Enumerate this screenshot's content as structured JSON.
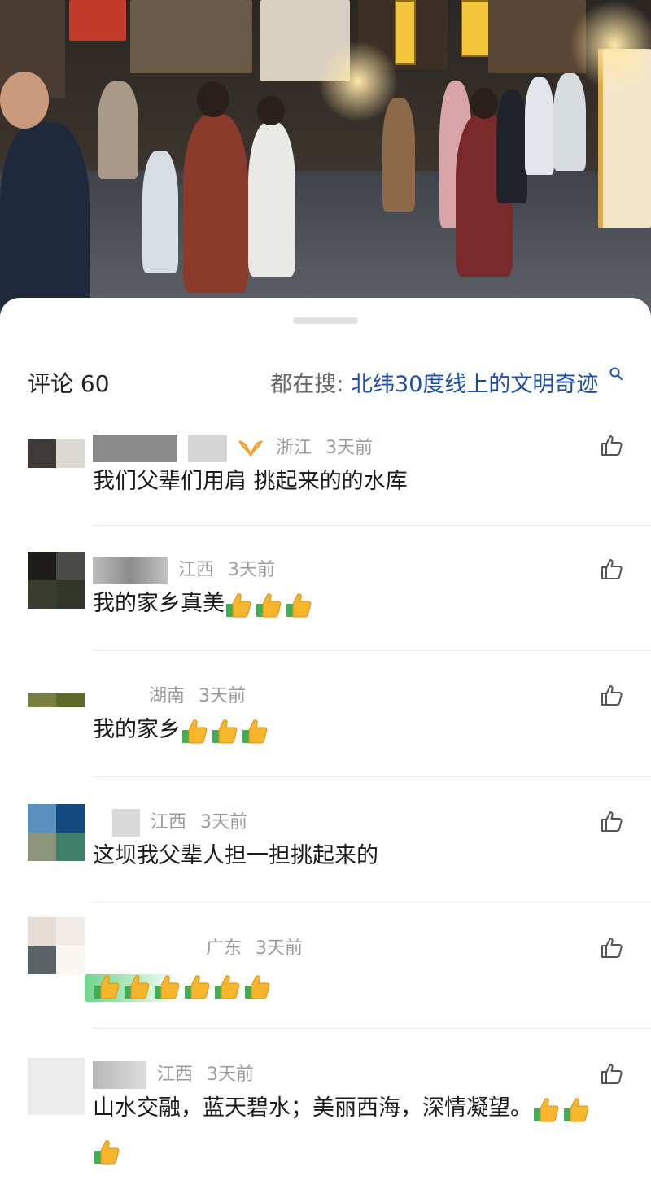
{
  "video": {
    "description_icon": "video-frame"
  },
  "header": {
    "comment_count_label": "评论 60",
    "trending_label": "都在搜:",
    "trending_term": "北纬30度线上的文明奇迹",
    "trending_icon": "search-icon"
  },
  "comments": [
    {
      "region": "浙江",
      "time": "3天前",
      "text": "我们父辈们用肩 挑起来的的水库",
      "thumbs": 0,
      "like_icon": "thumbs-up-outline-icon"
    },
    {
      "region": "江西",
      "time": "3天前",
      "text": "我的家乡真美",
      "thumbs": 3,
      "like_icon": "thumbs-up-outline-icon"
    },
    {
      "region": "湖南",
      "time": "3天前",
      "text": "我的家乡",
      "thumbs": 3,
      "like_icon": "thumbs-up-outline-icon"
    },
    {
      "region": "江西",
      "time": "3天前",
      "text": "这坝我父辈人担一担挑起来的",
      "thumbs": 0,
      "like_icon": "thumbs-up-outline-icon"
    },
    {
      "region": "广东",
      "time": "3天前",
      "text": "",
      "thumbs": 6,
      "like_icon": "thumbs-up-outline-icon"
    },
    {
      "region": "江西",
      "time": "3天前",
      "text": "山水交融，蓝天碧水；美丽西海，深情凝望。",
      "thumbs": 3,
      "like_icon": "thumbs-up-outline-icon"
    }
  ],
  "colors": {
    "trending_blue": "#1e4fa8",
    "meta_gray": "#9c9c9c",
    "thumb_yellow": "#f7b52c",
    "thumb_green": "#3fae55"
  }
}
